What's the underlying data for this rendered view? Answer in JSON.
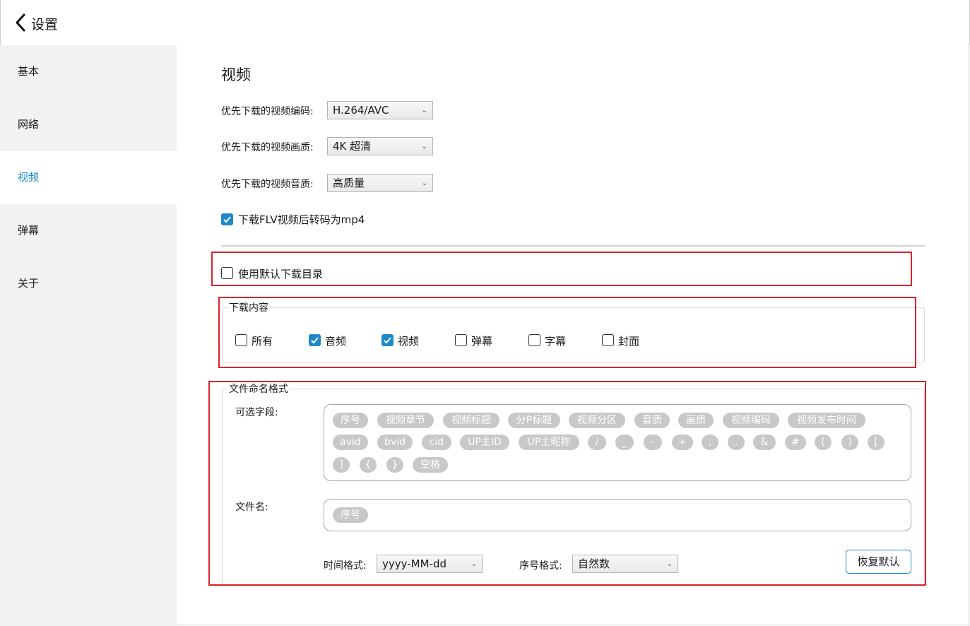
{
  "header": {
    "title": "设置",
    "back_icon": "chevron-left-icon"
  },
  "sidebar": {
    "items": [
      {
        "label": "基本",
        "active": false
      },
      {
        "label": "网络",
        "active": false
      },
      {
        "label": "视频",
        "active": true
      },
      {
        "label": "弹幕",
        "active": false
      },
      {
        "label": "关于",
        "active": false
      }
    ]
  },
  "colors": {
    "accent": "#1e88c9",
    "sidebar_bg": "#f2f2f2",
    "tag_bg": "#c8c8c8",
    "highlight_box": "#d8232a"
  },
  "main": {
    "title": "视频",
    "codec": {
      "label": "优先下载的视频编码:",
      "value": "H.264/AVC"
    },
    "quality": {
      "label": "优先下载的视频画质:",
      "value": "4K 超清"
    },
    "audio": {
      "label": "优先下载的视频音质:",
      "value": "高质量"
    },
    "flv_to_mp4": {
      "label": "下载FLV视频后转码为mp4",
      "checked": true
    },
    "use_default_dir": {
      "label": "使用默认下载目录",
      "checked": false
    },
    "download_content": {
      "legend": "下载内容",
      "options": [
        {
          "label": "所有",
          "checked": false
        },
        {
          "label": "音频",
          "checked": true
        },
        {
          "label": "视频",
          "checked": true
        },
        {
          "label": "弹幕",
          "checked": false
        },
        {
          "label": "字幕",
          "checked": false
        },
        {
          "label": "封面",
          "checked": false
        }
      ]
    },
    "naming": {
      "legend": "文件命名格式",
      "optional_label": "可选字段:",
      "optional_fields": [
        "序号",
        "视频章节",
        "视频标题",
        "分P标题",
        "视频分区",
        "音质",
        "画质",
        "视频编码",
        "视频发布时间",
        "avid",
        "bvid",
        "cid",
        "UP主ID",
        "UP主昵称",
        "/",
        "_",
        "-",
        "+",
        ",",
        ".",
        "&",
        "#",
        "(",
        ")",
        "[",
        "]",
        "{",
        "}",
        "空格"
      ],
      "filename_label": "文件名:",
      "filename_fields": [
        "序号"
      ],
      "time_format_label": "时间格式:",
      "time_format_value": "yyyy-MM-dd",
      "index_format_label": "序号格式:",
      "index_format_value": "自然数",
      "restore_label": "恢复默认"
    }
  }
}
